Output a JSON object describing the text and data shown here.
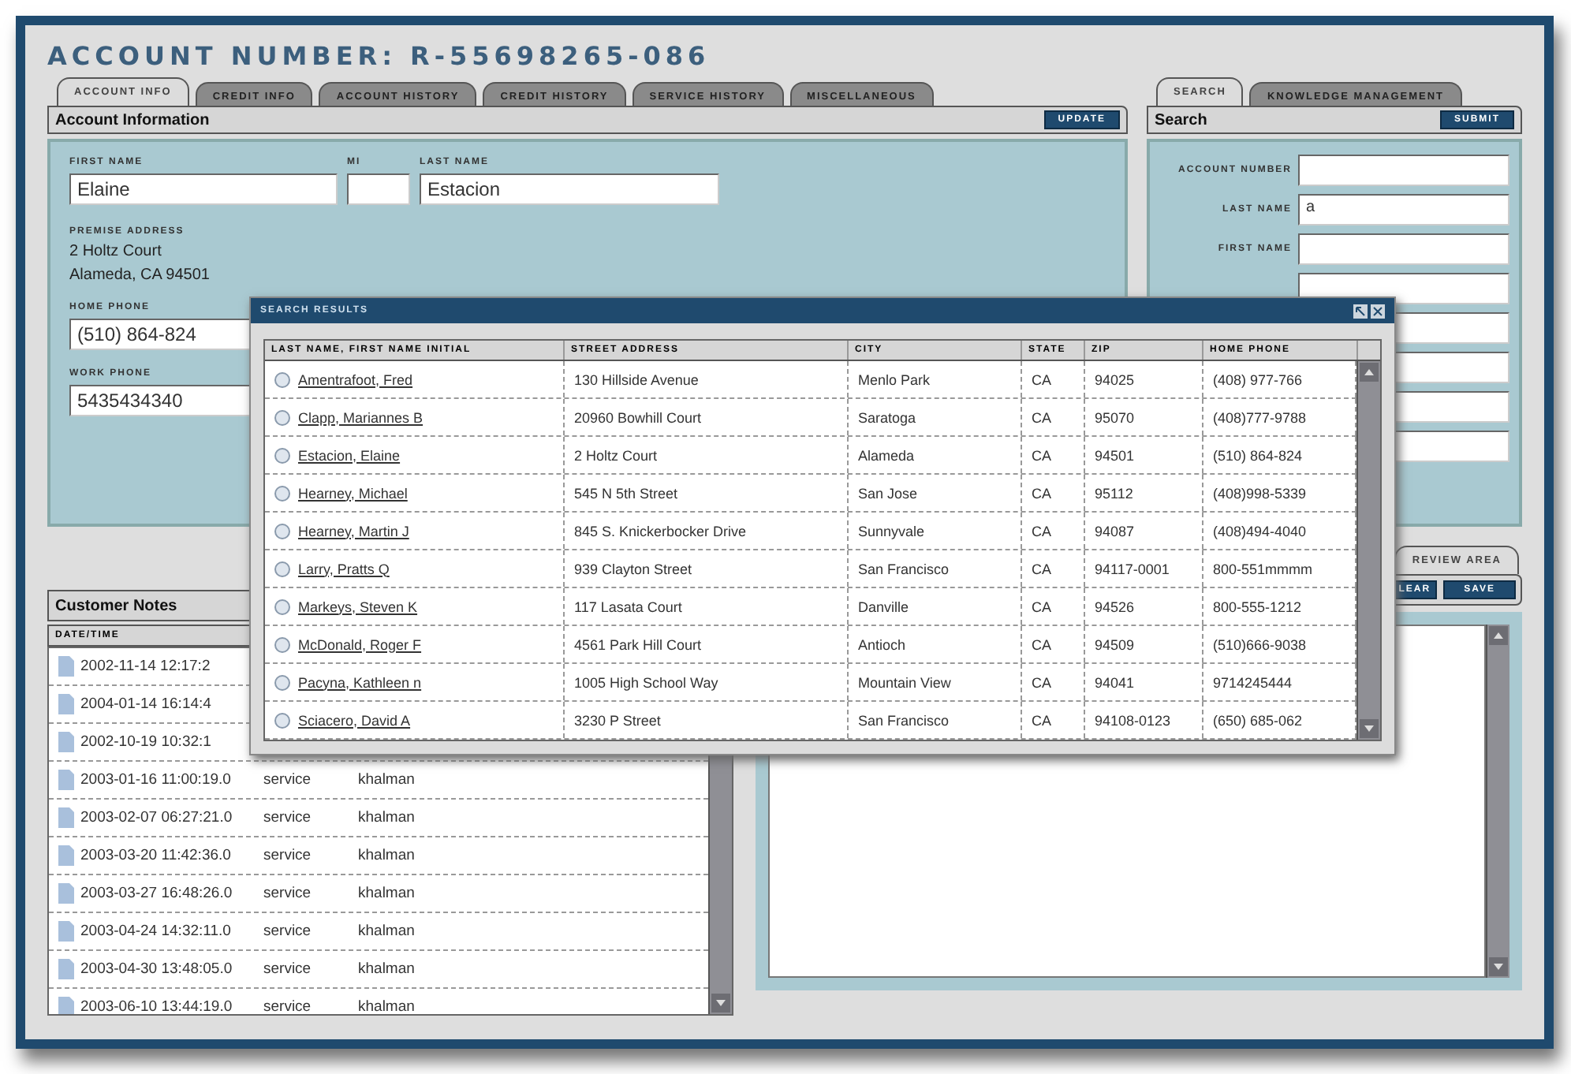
{
  "title": "ACCOUNT NUMBER: R-55698265-086",
  "account_tabs": [
    {
      "label": "ACCOUNT INFO",
      "selected": true
    },
    {
      "label": "CREDIT INFO",
      "selected": false
    },
    {
      "label": "ACCOUNT HISTORY",
      "selected": false
    },
    {
      "label": "CREDIT HISTORY",
      "selected": false
    },
    {
      "label": "SERVICE HISTORY",
      "selected": false
    },
    {
      "label": "MISCELLANEOUS",
      "selected": false
    }
  ],
  "account_panel": {
    "title": "Account Information",
    "button": "UPDATE",
    "name_fields": [
      {
        "label": "FIRST NAME",
        "value": "Elaine"
      },
      {
        "label": "MI",
        "kind": "short"
      },
      {
        "label": "LAST NAME",
        "value": "Estacion"
      }
    ],
    "address_label": "PREMISE ADDRESS",
    "address_lines": [
      "2 Holtz Court",
      "Alameda, CA 94501"
    ],
    "phones": [
      {
        "label": "HOME PHONE",
        "value": "(510) 864-824"
      },
      {
        "label": "WORK PHONE",
        "value": "5435434340"
      }
    ]
  },
  "search_tabs": [
    {
      "label": "SEARCH",
      "selected": true
    },
    {
      "label": "KNOWLEDGE MANAGEMENT",
      "selected": false
    }
  ],
  "search_panel": {
    "title": "Search",
    "button": "SUBMIT",
    "fields": [
      {
        "kind": "input",
        "label": "ACCOUNT NUMBER"
      },
      {
        "kind": "input",
        "label": "LAST NAME",
        "value": "a"
      },
      {
        "kind": "input",
        "label": "FIRST NAME"
      },
      {
        "kind": "input"
      },
      {
        "kind": "input"
      },
      {
        "kind": "input"
      },
      {
        "kind": "input"
      },
      {
        "kind": "input"
      }
    ]
  },
  "notes_panel": {
    "title": "Customer Notes",
    "column": "DATE/TIME",
    "rows": [
      {
        "date": "2002-11-14 12:17:2"
      },
      {
        "date": "2004-01-14 16:14:4"
      },
      {
        "date": "2002-10-19 10:32:1"
      },
      {
        "date": "2003-01-16 11:00:19.0",
        "type": "service",
        "user": "khalman"
      },
      {
        "date": "2003-02-07 06:27:21.0",
        "type": "service",
        "user": "khalman"
      },
      {
        "date": "2003-03-20 11:42:36.0",
        "type": "service",
        "user": "khalman"
      },
      {
        "date": "2003-03-27 16:48:26.0",
        "type": "service",
        "user": "khalman"
      },
      {
        "date": "2003-04-24 14:32:11.0",
        "type": "service",
        "user": "khalman"
      },
      {
        "date": "2003-04-30 13:48:05.0",
        "type": "service",
        "user": "khalman"
      },
      {
        "date": "2003-06-10 13:44:19.0",
        "type": "service",
        "user": "khalman"
      }
    ]
  },
  "review_tabs": [
    {
      "label": "REVIEW AREA",
      "selected": true
    }
  ],
  "review_buttons": [
    "LEAR",
    "SAVE"
  ],
  "search_results": {
    "title": "SEARCH RESULTS",
    "columns": [
      "LAST NAME, FIRST NAME  INITIAL",
      "STREET ADDRESS",
      "CITY",
      "STATE",
      "ZIP",
      "HOME PHONE"
    ],
    "rows": [
      {
        "selected": false,
        "cells": [
          "Amentrafoot, Fred",
          "130 Hillside Avenue",
          "Menlo Park",
          "CA",
          "94025",
          "(408) 977-766"
        ]
      },
      {
        "selected": false,
        "cells": [
          "Clapp, Mariannes B",
          "20960 Bowhill Court",
          "Saratoga",
          "CA",
          "95070",
          "(408)777-9788"
        ]
      },
      {
        "selected": false,
        "cells": [
          "Estacion, Elaine",
          "2 Holtz Court",
          "Alameda",
          "CA",
          "94501",
          "(510) 864-824"
        ]
      },
      {
        "selected": false,
        "cells": [
          "Hearney, Michael",
          "545 N 5th Street",
          "San Jose",
          "CA",
          "95112",
          "(408)998-5339"
        ]
      },
      {
        "selected": false,
        "cells": [
          "Hearney, Martin J",
          "845 S. Knickerbocker Drive",
          "Sunnyvale",
          "CA",
          "94087",
          "(408)494-4040"
        ]
      },
      {
        "selected": false,
        "cells": [
          "Larry, Pratts Q",
          "939 Clayton Street",
          "San Francisco",
          "CA",
          "94117-0001",
          "800-551mmmm"
        ]
      },
      {
        "selected": false,
        "cells": [
          "Markeys, Steven K",
          "117 Lasata Court",
          "Danville",
          "CA",
          "94526",
          "800-555-1212"
        ]
      },
      {
        "selected": false,
        "cells": [
          "McDonald, Roger F",
          "4561 Park Hill Court",
          "Antioch",
          "CA",
          "94509",
          "(510)666-9038"
        ]
      },
      {
        "selected": false,
        "cells": [
          "Pacyna, Kathleen n",
          "1005 High School Way",
          "Mountain View",
          "CA",
          "94041",
          "9714245444"
        ]
      },
      {
        "selected": false,
        "cells": [
          "Sciacero, David A",
          "3230 P Street",
          "San Francisco",
          "CA",
          "94108-0123",
          "(650) 685-062"
        ]
      }
    ]
  }
}
